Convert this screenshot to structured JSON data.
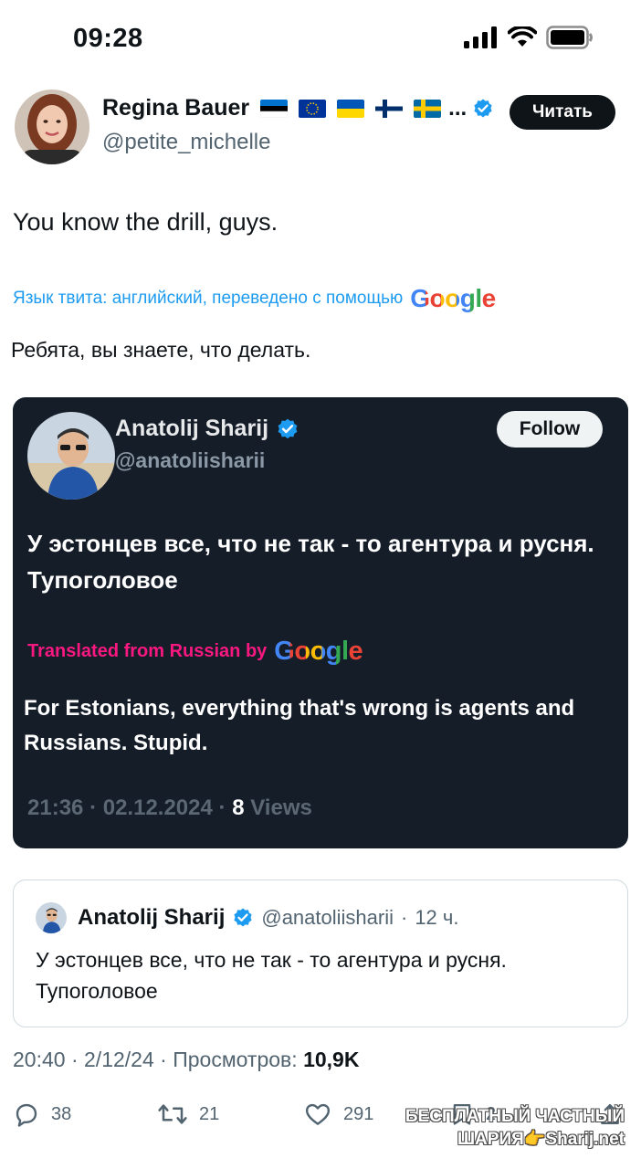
{
  "status_bar": {
    "time": "09:28",
    "icons": [
      "signal-icon",
      "wifi-icon",
      "battery-icon"
    ]
  },
  "tweet": {
    "author": {
      "name": "Regina Bauer",
      "flags": [
        "Estonia",
        "EU",
        "Ukraine",
        "Finland",
        "Sweden"
      ],
      "ellipsis": "...",
      "handle": "@petite_michelle",
      "follow_label": "Читать"
    },
    "text": "You know the drill, guys.",
    "translation_label": "Язык твита: английский, переведено с помощью",
    "translation_provider": "Google",
    "translated_text": "Ребята, вы знаете, что делать.",
    "meta": {
      "time": "20:40",
      "date": "2/12/24",
      "views_label": "Просмотров:",
      "views": "10,9K"
    },
    "actions": {
      "replies": "38",
      "retweets": "21",
      "likes": "291",
      "bookmarks": "2"
    }
  },
  "screenshot_card": {
    "name": "Anatolij Sharij",
    "handle": "@anatoliisharii",
    "follow_label": "Follow",
    "text": "У эстонцев все, что не так - то агентура и русня. Тупоголовое",
    "translation_label": "Translated from Russian by",
    "translation_provider": "Google",
    "translated_text": "For Estonians, everything that's wrong is agents and Russians. Stupid.",
    "time": "21:36",
    "date": "02.12.2024",
    "views_count": "8",
    "views_label": "Views"
  },
  "quoted_tweet": {
    "name": "Anatolij Sharij",
    "handle": "@anatoliisharii",
    "separator": "·",
    "age": "12 ч.",
    "text": "У эстонцев все, что не так - то агентура и русня. Тупоголовое"
  },
  "watermark": {
    "line1": "БЕСПЛАТНЫЙ ЧАСТНЫЙ",
    "line2": "ШАРИЯ👉Sharij.net"
  },
  "colors": {
    "link_blue": "#1d9bf0",
    "verified_blue": "#1d9bf0",
    "dark_card_bg": "#151d29",
    "pink_translate": "#f91880",
    "muted_text": "#536471"
  }
}
